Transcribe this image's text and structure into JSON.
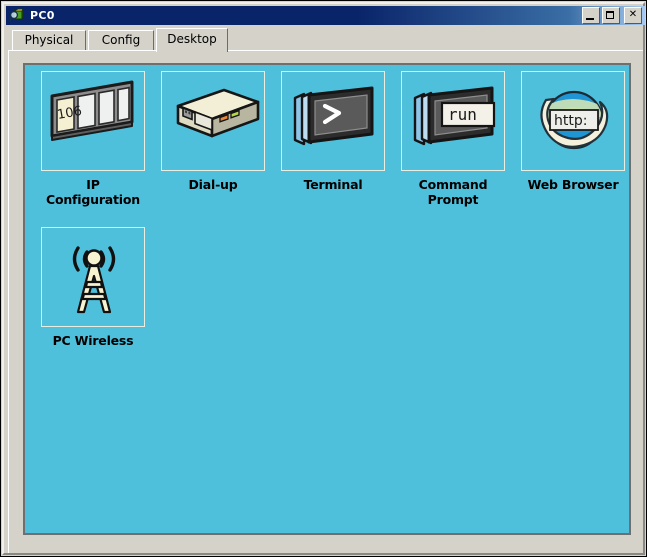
{
  "window": {
    "title": "PC0",
    "icon": "packet-tracer-magnifier-icon",
    "controls": {
      "minimize": "_",
      "maximize": "□",
      "close": "✕"
    }
  },
  "tabs": [
    {
      "label": "Physical",
      "active": false
    },
    {
      "label": "Config",
      "active": false
    },
    {
      "label": "Desktop",
      "active": true
    }
  ],
  "desktop": {
    "background_color": "#4fc0dc",
    "apps": [
      {
        "label": "IP\nConfiguration",
        "icon": "ip-configuration-icon",
        "icon_text": "106"
      },
      {
        "label": "Dial-up",
        "icon": "dial-up-modem-icon"
      },
      {
        "label": "Terminal",
        "icon": "terminal-icon",
        "icon_text": ">"
      },
      {
        "label": "Command\nPrompt",
        "icon": "command-prompt-icon",
        "icon_text": "run"
      },
      {
        "label": "Web Browser",
        "icon": "web-browser-globe-icon",
        "icon_text": "http:"
      },
      {
        "label": "PC Wireless",
        "icon": "pc-wireless-tower-icon"
      }
    ]
  }
}
